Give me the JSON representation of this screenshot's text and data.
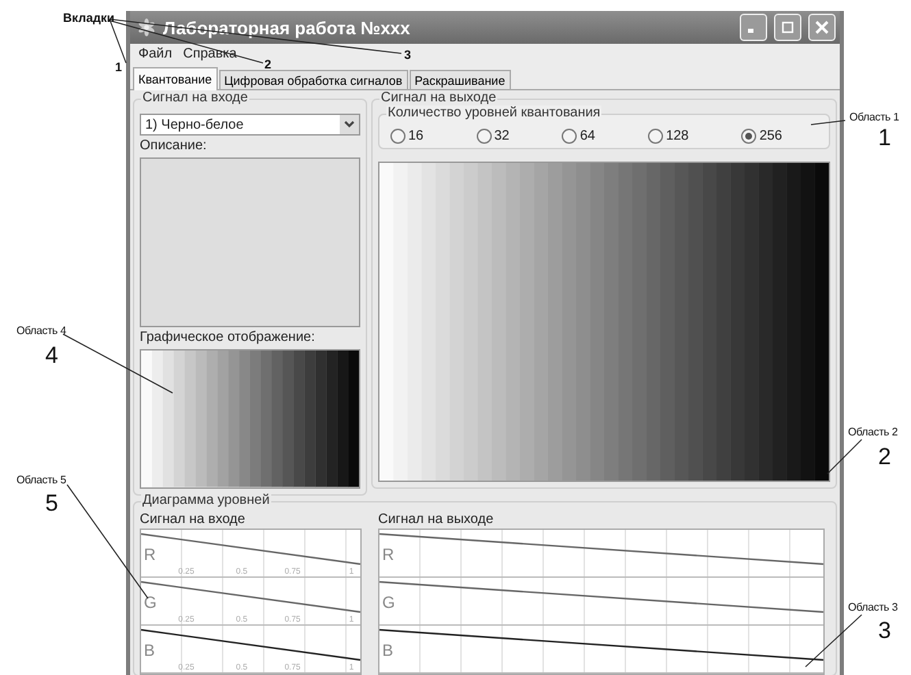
{
  "window": {
    "title": "Лабораторная работа №xxx"
  },
  "menu": [
    {
      "label": "Файл"
    },
    {
      "label": "Справка"
    }
  ],
  "tabs": [
    {
      "label": "Квантование",
      "selected": true
    },
    {
      "label": "Цифровая обработка сигналов",
      "selected": false
    },
    {
      "label": "Раскрашивание",
      "selected": false
    }
  ],
  "input_signal": {
    "title": "Сигнал на входе",
    "dropdown": {
      "value": "1) Черно-белое"
    },
    "description_label": "Описание:",
    "graphic_label": "Графическое отображение:"
  },
  "output_signal": {
    "title": "Сигнал на выходе",
    "levels_group": {
      "title": "Количество уровней квантования",
      "options": [
        {
          "label": "16",
          "selected": false
        },
        {
          "label": "32",
          "selected": false
        },
        {
          "label": "64",
          "selected": false
        },
        {
          "label": "128",
          "selected": false
        },
        {
          "label": "256",
          "selected": true
        }
      ]
    }
  },
  "level_diagram": {
    "title": "Диаграмма уровней",
    "panels": [
      {
        "title": "Сигнал на входе",
        "channels": [
          {
            "label": "R",
            "tick_labels": [
              "0.25",
              "0.5",
              "0.75",
              "1"
            ]
          },
          {
            "label": "G",
            "tick_labels": [
              "0.25",
              "0.5",
              "0.75",
              "1"
            ]
          },
          {
            "label": "B",
            "tick_labels": [
              "0.25",
              "0.5",
              "0.75",
              "1"
            ]
          }
        ]
      },
      {
        "title": "Сигнал на выходе",
        "channels": [
          {
            "label": "R"
          },
          {
            "label": "G"
          },
          {
            "label": "B"
          }
        ]
      }
    ]
  },
  "annotations": {
    "tabs_label": "Вкладки",
    "tab_markers": [
      "1",
      "2",
      "3"
    ],
    "areas": [
      {
        "label": "Область 1",
        "number": "1"
      },
      {
        "label": "Область 2",
        "number": "2"
      },
      {
        "label": "Область 3",
        "number": "3"
      },
      {
        "label": "Область 4",
        "number": "4"
      },
      {
        "label": "Область 5",
        "number": "5"
      }
    ]
  }
}
